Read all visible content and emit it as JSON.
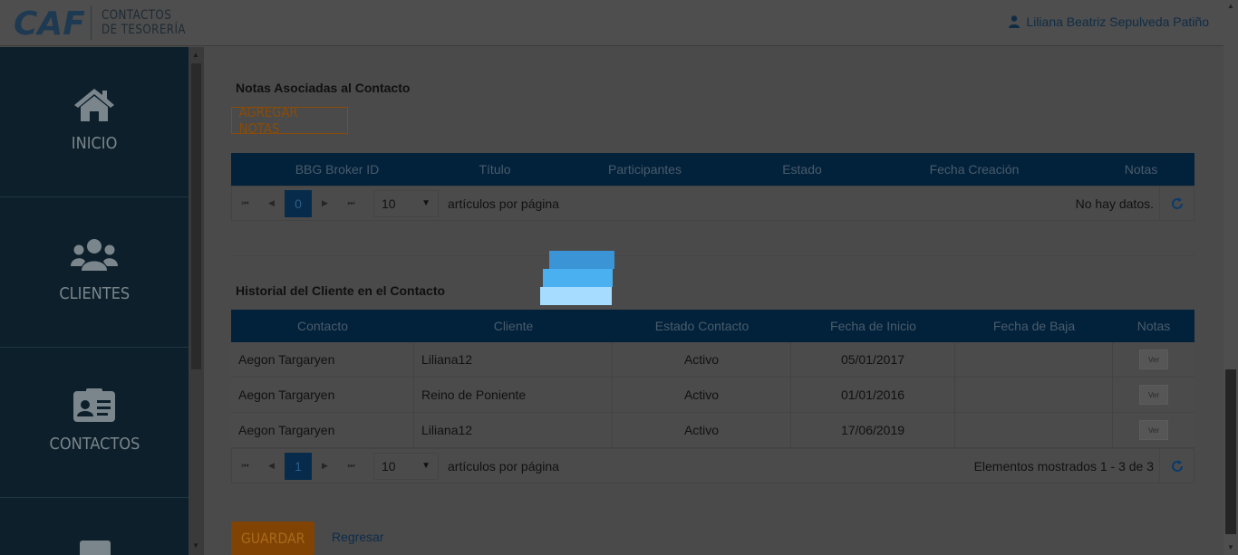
{
  "header": {
    "logo_text": "CAF",
    "title_line1": "CONTACTOS",
    "title_line2": "DE TESORERÍA",
    "user_name": "Liliana Beatriz Sepulveda Patiño"
  },
  "sidebar": {
    "items": [
      {
        "label": "INICIO",
        "icon": "home-icon"
      },
      {
        "label": "CLIENTES",
        "icon": "users-icon"
      },
      {
        "label": "CONTACTOS",
        "icon": "contact-card-icon"
      }
    ]
  },
  "notes_section": {
    "title": "Notas Asociadas al Contacto",
    "add_button": "AGREGAR NOTAS",
    "columns": [
      "BBG Broker ID",
      "Título",
      "Participantes",
      "Estado",
      "Fecha Creación",
      "Notas"
    ],
    "pager": {
      "current_page": "0",
      "page_size": "10",
      "per_page_text": "artículos por página",
      "info": "No hay datos."
    }
  },
  "history_section": {
    "title": "Historial del Cliente en el Contacto",
    "columns": [
      "Contacto",
      "Cliente",
      "Estado Contacto",
      "Fecha de Inicio",
      "Fecha de Baja",
      "Notas"
    ],
    "rows": [
      {
        "contacto": "Aegon Targaryen",
        "cliente": "Liliana12",
        "estado": "Activo",
        "inicio": "05/01/2017",
        "baja": "",
        "notas": "Ver"
      },
      {
        "contacto": "Aegon Targaryen",
        "cliente": "Reino de Poniente",
        "estado": "Activo",
        "inicio": "01/01/2016",
        "baja": "",
        "notas": "Ver"
      },
      {
        "contacto": "Aegon Targaryen",
        "cliente": "Liliana12",
        "estado": "Activo",
        "inicio": "17/06/2019",
        "baja": "",
        "notas": "Ver"
      }
    ],
    "pager": {
      "current_page": "1",
      "page_size": "10",
      "per_page_text": "artículos por página",
      "info": "Elementos mostrados 1 - 3 de 3"
    }
  },
  "actions": {
    "save_button": "GUARDAR",
    "back_link": "Regresar"
  },
  "colors": {
    "overlay_dim": "#4a4a4a",
    "sidebar_bg": "#0c1f2a",
    "grid_header": "#02213b",
    "accent_orange": "#804304",
    "spinner_blues": [
      "#3a94d6",
      "#4ab0f0",
      "#a6dcff"
    ]
  }
}
